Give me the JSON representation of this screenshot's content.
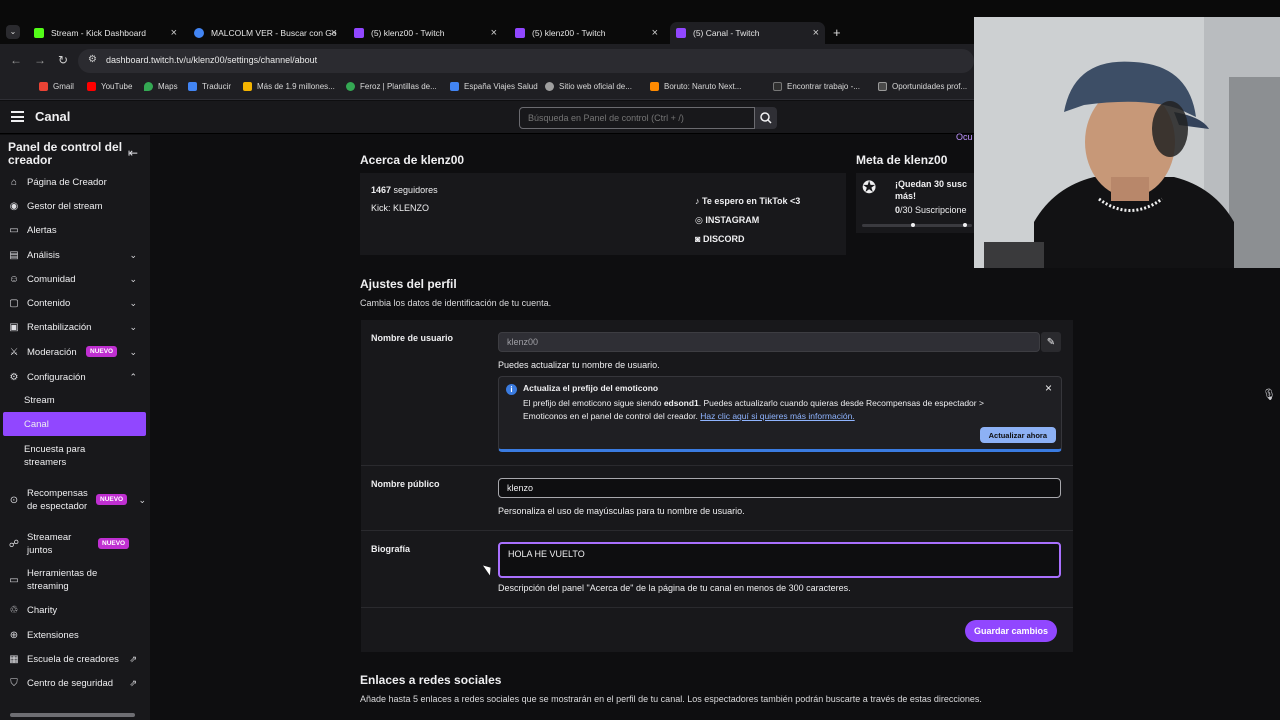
{
  "browser": {
    "tabs": [
      {
        "title": "Stream - Kick Dashboard",
        "active": false,
        "color": "#53fc18"
      },
      {
        "title": "MALCOLM VER - Buscar con Go",
        "active": false,
        "color": "#4285f4"
      },
      {
        "title": "(5) klenz00 - Twitch",
        "active": false,
        "color": "#9147ff"
      },
      {
        "title": "(5) klenz00 - Twitch",
        "active": false,
        "color": "#9147ff"
      },
      {
        "title": "(5) Canal - Twitch",
        "active": true,
        "color": "#9147ff"
      }
    ],
    "new_tab": "+",
    "url": "dashboard.twitch.tv/u/klenz00/settings/channel/about",
    "bookmarks": [
      {
        "label": "Gmail",
        "color": "#ea4335"
      },
      {
        "label": "YouTube",
        "color": "#ff0000"
      },
      {
        "label": "Maps",
        "color": "#34a853"
      },
      {
        "label": "Traducir",
        "color": "#4285f4"
      },
      {
        "label": "Más de 1.9 millones...",
        "color": "#f4b400"
      },
      {
        "label": "Feroz | Plantillas de...",
        "color": "#34a853"
      },
      {
        "label": "España Viajes Salud",
        "color": "#4285f4"
      },
      {
        "label": "Sitio web oficial de...",
        "color": "#9e9e9e"
      },
      {
        "label": "Boruto: Naruto Next...",
        "color": "#ff8a00"
      },
      {
        "label": "Encontrar trabajo -...",
        "color": "#2f2f2f"
      },
      {
        "label": "Oportunidades prof...",
        "color": "#4a4a4a"
      }
    ]
  },
  "topbar": {
    "title": "Canal",
    "search_placeholder": "Búsqueda en Panel de control (Ctrl + /)"
  },
  "sidebar": {
    "title": "Panel de control del creador",
    "items": [
      {
        "label": "Página de Creador",
        "icon": "home-icon"
      },
      {
        "label": "Gestor del stream",
        "icon": "stream-manager-icon"
      },
      {
        "label": "Alertas",
        "icon": "alerts-icon"
      },
      {
        "label": "Análisis",
        "icon": "analytics-icon"
      },
      {
        "label": "Comunidad",
        "icon": "community-icon"
      },
      {
        "label": "Contenido",
        "icon": "content-icon"
      },
      {
        "label": "Rentabilización",
        "icon": "monetization-icon"
      },
      {
        "label": "Moderación",
        "icon": "moderation-icon",
        "badge": "NUEVO"
      },
      {
        "label": "Configuración",
        "icon": "settings-icon"
      }
    ],
    "subitems": [
      "Stream",
      "Canal",
      "Encuesta para streamers"
    ],
    "items2": [
      {
        "label": "Recompensas de espectador",
        "icon": "rewards-icon",
        "badge": "NUEVO"
      },
      {
        "label": "Streamear juntos",
        "icon": "stream-together-icon",
        "badge": "NUEVO"
      },
      {
        "label": "Herramientas de streaming",
        "icon": "tools-icon"
      },
      {
        "label": "Charity",
        "icon": "charity-icon"
      },
      {
        "label": "Extensiones",
        "icon": "extensions-icon"
      },
      {
        "label": "Escuela de creadores",
        "icon": "school-icon"
      },
      {
        "label": "Centro de seguridad",
        "icon": "safety-icon"
      }
    ]
  },
  "about": {
    "title": "Acerca de klenz00",
    "followers_count": "1467",
    "followers_label": "seguidores",
    "kick": "Kick: KLENZO",
    "links": [
      "Te espero en TikTok <3",
      "INSTAGRAM",
      "DISCORD"
    ]
  },
  "goal": {
    "title": "Meta de klenz00",
    "line1": "¡Quedan 30 susc",
    "line2": "más!",
    "progress_count": "0",
    "progress_rest": "/30 Suscripcione",
    "hidden_link": "Ocu"
  },
  "profile": {
    "title": "Ajustes del perfil",
    "subtitle": "Cambia los datos de identificación de tu cuenta.",
    "username_label": "Nombre de usuario",
    "username_value": "klenz00",
    "username_help": "Puedes actualizar tu nombre de usuario.",
    "info_title": "Actualiza el prefijo del emoticono",
    "info_text_1": "El prefijo del emoticono sigue siendo ",
    "info_prefix": "edsond1",
    "info_text_2": ". Puedes actualizarlo cuando quieras desde Recompensas de espectador > Emoticonos en el panel de control del creador. ",
    "info_link": "Haz clic aquí si quieres más información.",
    "info_button": "Actualizar ahora",
    "display_name_label": "Nombre público",
    "display_name_value": "klenzo",
    "display_name_help": "Personaliza el uso de mayúsculas para tu nombre de usuario.",
    "bio_label": "Biografía",
    "bio_value": "HOLA HE VUELTO",
    "bio_help": "Descripción del panel \"Acerca de\" de la página de tu canal en menos de 300 caracteres.",
    "save_button": "Guardar cambios"
  },
  "social": {
    "title": "Enlaces a redes sociales",
    "subtitle": "Añade hasta 5 enlaces a redes sociales que se mostrarán en el perfil de tu canal. Los espectadores también podrán buscarte a través de estas direcciones."
  },
  "colors": {
    "accent": "#9147ff",
    "focus": "#a970ff",
    "info": "#3a7be0",
    "badge": "#bf2fd1"
  }
}
